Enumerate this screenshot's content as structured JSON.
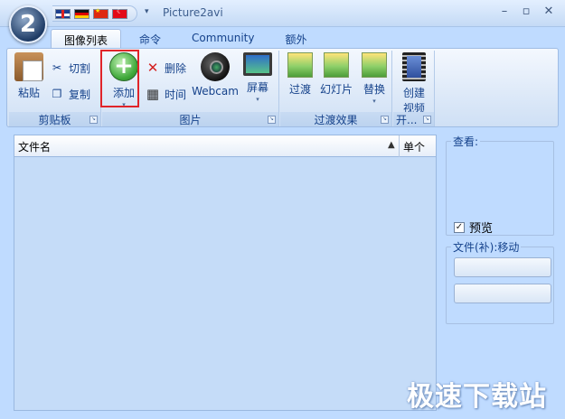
{
  "window": {
    "title": "Picture2avi",
    "orb_text": "2",
    "flags": [
      "uk-flag",
      "germany-flag",
      "china-flag",
      "turkey-flag"
    ],
    "qat_arrow": "▾",
    "controls": {
      "minimize": "–",
      "maximize": "▫",
      "close": "✕"
    }
  },
  "tabs": [
    {
      "label": "图像列表",
      "active": true
    },
    {
      "label": "命令",
      "active": false
    },
    {
      "label": "Community",
      "active": false
    },
    {
      "label": "额外",
      "active": false
    }
  ],
  "ribbon": {
    "clipboard": {
      "label": "剪贴板",
      "paste": "粘贴",
      "cut": "切割",
      "copy": "复制"
    },
    "pictures": {
      "label": "图片",
      "add": "添加",
      "delete": "删除",
      "time": "时间",
      "webcam": "Webcam",
      "screen": "屏幕"
    },
    "transitions": {
      "label": "过渡效果",
      "transition": "过渡",
      "slideshow": "幻灯片",
      "replace": "替换"
    },
    "open": {
      "label": "开...",
      "create_video": "创建",
      "create_video_line2": "视频"
    }
  },
  "list": {
    "columns": [
      "文件名",
      "单个"
    ],
    "sort_indicator": "▲",
    "rows": []
  },
  "side_panel": {
    "view_label": "查看:",
    "preview_label": "预览",
    "preview_checked": true,
    "file_label": "文件(补):移动"
  },
  "watermark": "极速下载站",
  "colors": {
    "accent_highlight": "#e0242a",
    "ribbon_text": "#15428b",
    "list_bg": "#c5dcf8"
  }
}
